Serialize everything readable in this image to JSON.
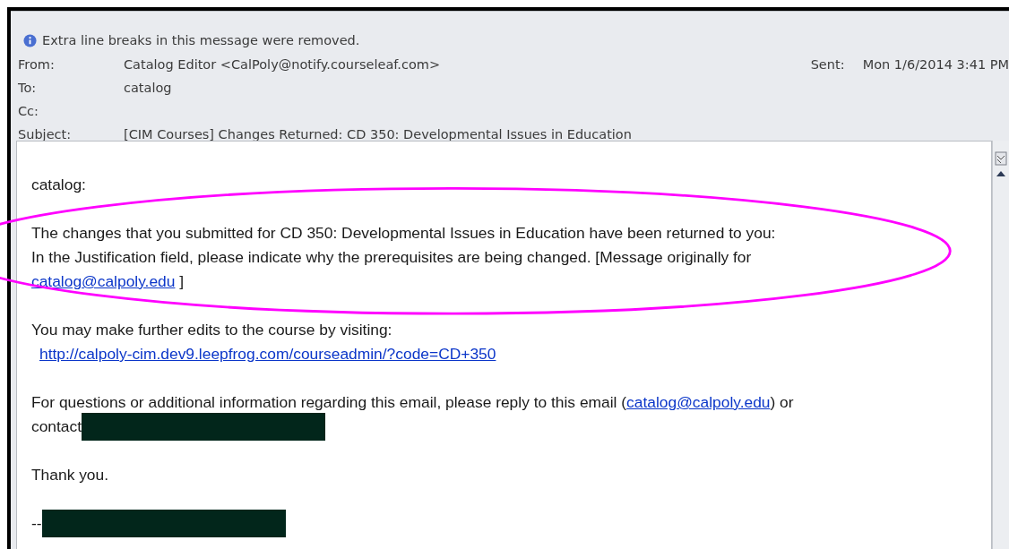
{
  "info_bar": {
    "text": "Extra line breaks in this message were removed."
  },
  "header": {
    "fields": [
      {
        "label": "From:",
        "value": "Catalog Editor <CalPoly@notify.courseleaf.com>"
      },
      {
        "label": "To:",
        "value": "catalog"
      },
      {
        "label": "Cc:"
      },
      {
        "label": "Subject:",
        "value": "[CIM Courses] Changes Returned: CD 350: Developmental Issues in Education"
      }
    ],
    "sent": {
      "label": "Sent:",
      "value": "Mon 1/6/2014 3:41 PM"
    }
  },
  "body": [
    {
      "lines": [
        [
          {
            "kind": "text",
            "text": "catalog:"
          }
        ]
      ]
    },
    {
      "lines": [
        [
          {
            "kind": "text",
            "text": "The changes that you submitted for CD 350: Developmental Issues in Education have been returned to you:"
          }
        ],
        [
          {
            "kind": "text",
            "text": "In the Justification field, please indicate why the prerequisites are being changed. [Message originally for"
          }
        ],
        [
          {
            "kind": "link",
            "text": "catalog@calpoly.edu"
          },
          {
            "kind": "text",
            "text": " ]"
          }
        ]
      ]
    },
    {
      "lines": [
        [
          {
            "kind": "text",
            "text": "You may make further edits to the course by visiting:"
          }
        ],
        [
          {
            "kind": "url",
            "text": "http://calpoly-cim.dev9.leepfrog.com/courseadmin/?code=CD+350"
          }
        ]
      ]
    },
    {
      "lines": [
        [
          {
            "kind": "text",
            "text": "For questions or additional information regarding this email, please reply to this email ("
          },
          {
            "kind": "link",
            "text": "catalog@calpoly.edu"
          },
          {
            "kind": "text",
            "text": ") or"
          }
        ],
        [
          {
            "kind": "text",
            "text": "contact"
          },
          {
            "kind": "redaction"
          }
        ]
      ]
    },
    {
      "lines": [
        [
          {
            "kind": "text",
            "text": "Thank you."
          }
        ]
      ]
    },
    {
      "lines": [
        [
          {
            "kind": "text",
            "text": "--"
          },
          {
            "kind": "redaction"
          }
        ]
      ]
    }
  ]
}
